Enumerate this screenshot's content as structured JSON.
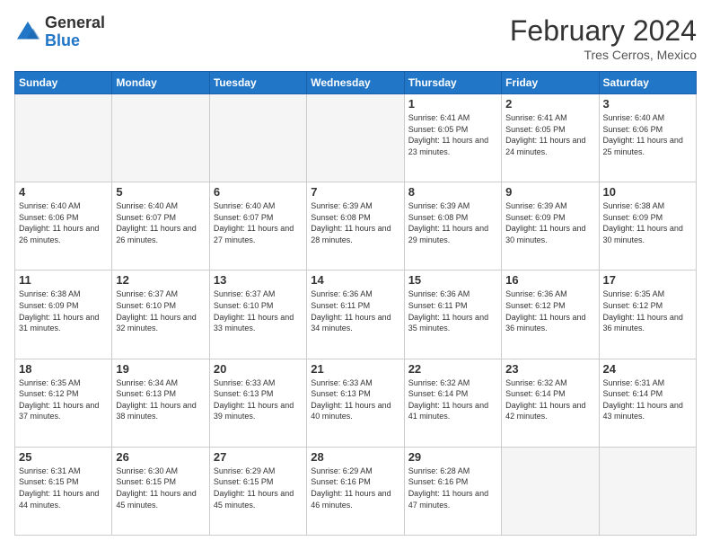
{
  "header": {
    "logo_general": "General",
    "logo_blue": "Blue",
    "title": "February 2024",
    "location": "Tres Cerros, Mexico"
  },
  "days_of_week": [
    "Sunday",
    "Monday",
    "Tuesday",
    "Wednesday",
    "Thursday",
    "Friday",
    "Saturday"
  ],
  "weeks": [
    [
      {
        "day": "",
        "empty": true
      },
      {
        "day": "",
        "empty": true
      },
      {
        "day": "",
        "empty": true
      },
      {
        "day": "",
        "empty": true
      },
      {
        "day": "1",
        "sunrise": "6:41 AM",
        "sunset": "6:05 PM",
        "daylight": "11 hours and 23 minutes."
      },
      {
        "day": "2",
        "sunrise": "6:41 AM",
        "sunset": "6:05 PM",
        "daylight": "11 hours and 24 minutes."
      },
      {
        "day": "3",
        "sunrise": "6:40 AM",
        "sunset": "6:06 PM",
        "daylight": "11 hours and 25 minutes."
      }
    ],
    [
      {
        "day": "4",
        "sunrise": "6:40 AM",
        "sunset": "6:06 PM",
        "daylight": "11 hours and 26 minutes."
      },
      {
        "day": "5",
        "sunrise": "6:40 AM",
        "sunset": "6:07 PM",
        "daylight": "11 hours and 26 minutes."
      },
      {
        "day": "6",
        "sunrise": "6:40 AM",
        "sunset": "6:07 PM",
        "daylight": "11 hours and 27 minutes."
      },
      {
        "day": "7",
        "sunrise": "6:39 AM",
        "sunset": "6:08 PM",
        "daylight": "11 hours and 28 minutes."
      },
      {
        "day": "8",
        "sunrise": "6:39 AM",
        "sunset": "6:08 PM",
        "daylight": "11 hours and 29 minutes."
      },
      {
        "day": "9",
        "sunrise": "6:39 AM",
        "sunset": "6:09 PM",
        "daylight": "11 hours and 30 minutes."
      },
      {
        "day": "10",
        "sunrise": "6:38 AM",
        "sunset": "6:09 PM",
        "daylight": "11 hours and 30 minutes."
      }
    ],
    [
      {
        "day": "11",
        "sunrise": "6:38 AM",
        "sunset": "6:09 PM",
        "daylight": "11 hours and 31 minutes."
      },
      {
        "day": "12",
        "sunrise": "6:37 AM",
        "sunset": "6:10 PM",
        "daylight": "11 hours and 32 minutes."
      },
      {
        "day": "13",
        "sunrise": "6:37 AM",
        "sunset": "6:10 PM",
        "daylight": "11 hours and 33 minutes."
      },
      {
        "day": "14",
        "sunrise": "6:36 AM",
        "sunset": "6:11 PM",
        "daylight": "11 hours and 34 minutes."
      },
      {
        "day": "15",
        "sunrise": "6:36 AM",
        "sunset": "6:11 PM",
        "daylight": "11 hours and 35 minutes."
      },
      {
        "day": "16",
        "sunrise": "6:36 AM",
        "sunset": "6:12 PM",
        "daylight": "11 hours and 36 minutes."
      },
      {
        "day": "17",
        "sunrise": "6:35 AM",
        "sunset": "6:12 PM",
        "daylight": "11 hours and 36 minutes."
      }
    ],
    [
      {
        "day": "18",
        "sunrise": "6:35 AM",
        "sunset": "6:12 PM",
        "daylight": "11 hours and 37 minutes."
      },
      {
        "day": "19",
        "sunrise": "6:34 AM",
        "sunset": "6:13 PM",
        "daylight": "11 hours and 38 minutes."
      },
      {
        "day": "20",
        "sunrise": "6:33 AM",
        "sunset": "6:13 PM",
        "daylight": "11 hours and 39 minutes."
      },
      {
        "day": "21",
        "sunrise": "6:33 AM",
        "sunset": "6:13 PM",
        "daylight": "11 hours and 40 minutes."
      },
      {
        "day": "22",
        "sunrise": "6:32 AM",
        "sunset": "6:14 PM",
        "daylight": "11 hours and 41 minutes."
      },
      {
        "day": "23",
        "sunrise": "6:32 AM",
        "sunset": "6:14 PM",
        "daylight": "11 hours and 42 minutes."
      },
      {
        "day": "24",
        "sunrise": "6:31 AM",
        "sunset": "6:14 PM",
        "daylight": "11 hours and 43 minutes."
      }
    ],
    [
      {
        "day": "25",
        "sunrise": "6:31 AM",
        "sunset": "6:15 PM",
        "daylight": "11 hours and 44 minutes."
      },
      {
        "day": "26",
        "sunrise": "6:30 AM",
        "sunset": "6:15 PM",
        "daylight": "11 hours and 45 minutes."
      },
      {
        "day": "27",
        "sunrise": "6:29 AM",
        "sunset": "6:15 PM",
        "daylight": "11 hours and 45 minutes."
      },
      {
        "day": "28",
        "sunrise": "6:29 AM",
        "sunset": "6:16 PM",
        "daylight": "11 hours and 46 minutes."
      },
      {
        "day": "29",
        "sunrise": "6:28 AM",
        "sunset": "6:16 PM",
        "daylight": "11 hours and 47 minutes."
      },
      {
        "day": "",
        "empty": true
      },
      {
        "day": "",
        "empty": true
      }
    ]
  ]
}
